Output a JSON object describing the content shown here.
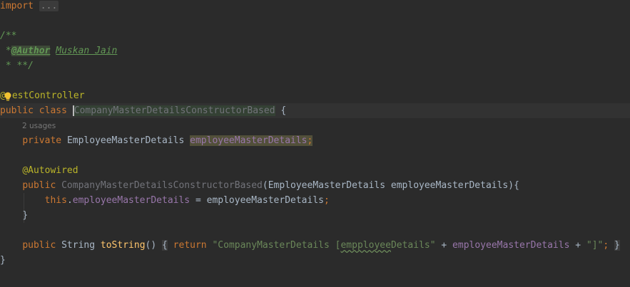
{
  "code": {
    "import_kw": "import",
    "import_fold": "...",
    "doc_open": "/**",
    "doc_star": " *",
    "doc_tag": "@Author",
    "doc_space": " ",
    "doc_author": "Muskan Jain",
    "doc_close": " * **/",
    "annotation_at": "@",
    "annotation_rest": "estController",
    "class_public": "public",
    "class_class": "class",
    "class_name": "CompanyMasterDetailsConstructorBased",
    "class_brace": "{",
    "usages_hint": "2 usages",
    "field_private": "private",
    "field_type": "EmployeeMasterDetails",
    "field_name": "employeeMasterDetails",
    "semicolon": ";",
    "autowired": "@Autowired",
    "ctor_public": "public",
    "ctor_name": "CompanyMasterDetailsConstructorBased",
    "ctor_params": "(EmployeeMasterDetails employeeMasterDetails){",
    "this_kw": "this",
    "this_dot": ".",
    "this_field": "employeeMasterDetails",
    "assign": " = employeeMasterDetails",
    "close_brace": "}",
    "ts_public": "public",
    "ts_type": "String",
    "ts_name": "toString",
    "ts_parens": "()",
    "ts_open": "{",
    "ts_return": "return",
    "ts_str1_a": "\"CompanyMasterDetails [",
    "ts_str1_typo": "empployee",
    "ts_str1_b": "Details\"",
    "ts_plus": " + ",
    "ts_field": "employeeMasterDetails",
    "ts_str2": "\"]\"",
    "ts_close": "}",
    "class_close": "}"
  },
  "colors": {
    "background": "#2b2b2b",
    "keyword": "#cc7832",
    "annotation": "#bbb529",
    "doc_comment": "#629755",
    "field": "#9876aa",
    "method": "#ffc66d",
    "string": "#6a8759",
    "text": "#a9b7c6"
  },
  "icons": {
    "intention": "lightbulb-icon"
  }
}
